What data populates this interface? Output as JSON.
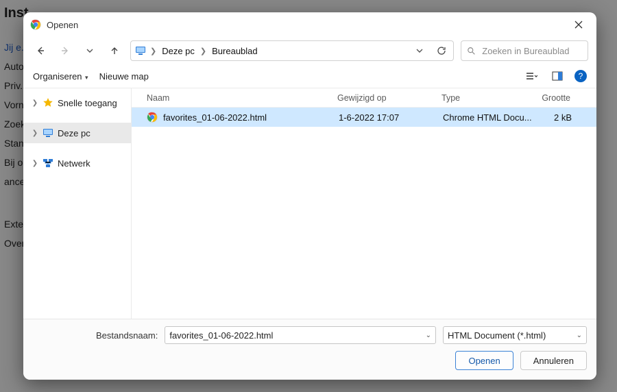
{
  "background": {
    "title": "Inst...",
    "link": "Jij e...",
    "lines": [
      "Auto...",
      "Priv...",
      "Vorn...",
      "Zoek...",
      "Stan...",
      "Bij o...",
      "ancee...",
      "Exte...",
      "Over..."
    ]
  },
  "dialog": {
    "title": "Openen",
    "nav": {
      "breadcrumb": {
        "root": "Deze pc",
        "folder": "Bureaublad"
      }
    },
    "search": {
      "placeholder": "Zoeken in Bureaublad"
    },
    "toolbar": {
      "organize": "Organiseren",
      "newfolder": "Nieuwe map"
    },
    "tree": {
      "quick": "Snelle toegang",
      "thispc": "Deze pc",
      "network": "Netwerk"
    },
    "columns": {
      "name": "Naam",
      "modified": "Gewijzigd op",
      "type": "Type",
      "size": "Grootte"
    },
    "rows": [
      {
        "name": "favorites_01-06-2022.html",
        "modified": "1-6-2022 17:07",
        "type": "Chrome HTML Docu...",
        "size": "2 kB"
      }
    ],
    "footer": {
      "filename_label": "Bestandsnaam:",
      "filename_value": "favorites_01-06-2022.html",
      "filetype_value": "HTML Document (*.html)",
      "open": "Openen",
      "cancel": "Annuleren"
    }
  }
}
